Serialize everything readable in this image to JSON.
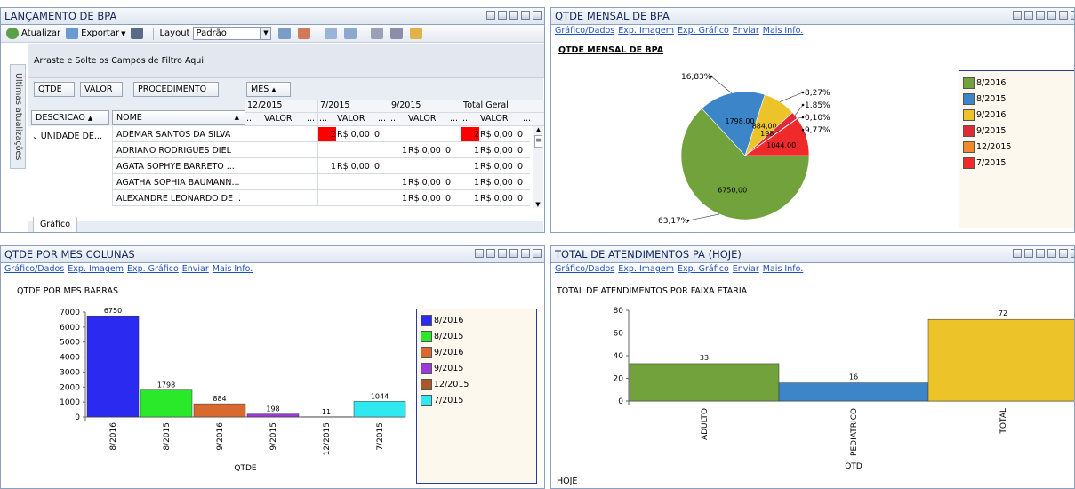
{
  "panels": {
    "bpa": {
      "title": "LANÇAMENTO DE BPA",
      "toolbar": {
        "atualizar": "Atualizar",
        "exportar": "Exportar",
        "layout_label": "Layout",
        "layout_value": "Padrão"
      },
      "side_tab": "Últimas atualizações",
      "filter_drop": "Arraste e Solte os Campos de Filtro Aqui",
      "data_fields": [
        "QTDE",
        "VALOR",
        "PROCEDIMENTO"
      ],
      "col_field": "MES",
      "row_fields": [
        "DESCRICAO",
        "NOME"
      ],
      "col_groups": [
        "12/2015",
        "7/2015",
        "9/2015",
        "Total Geral"
      ],
      "sub_headers": {
        "dots": "...",
        "valor": "VALOR"
      },
      "group_label": "UNIDADE DE...",
      "rows": [
        {
          "nome": "ADEMAR SANTOS DA SILVA",
          "g7_q": "2",
          "g7_v": "R$ 0,00",
          "g7_x": "0",
          "g9_q": "",
          "g9_v": "",
          "g9_x": "",
          "t_q": "2",
          "t_v": "R$ 0,00",
          "t_x": "0"
        },
        {
          "nome": "ADRIANO RODRIGUES DIEL",
          "g7_q": "",
          "g7_v": "",
          "g7_x": "",
          "g9_q": "1",
          "g9_v": "R$ 0,00",
          "g9_x": "0",
          "t_q": "1",
          "t_v": "R$ 0,00",
          "t_x": "0"
        },
        {
          "nome": "AGATA SOPHYE BARRETO ...",
          "g7_q": "1",
          "g7_v": "R$ 0,00",
          "g7_x": "0",
          "g9_q": "",
          "g9_v": "",
          "g9_x": "",
          "t_q": "1",
          "t_v": "R$ 0,00",
          "t_x": "0"
        },
        {
          "nome": "AGATHA SOPHIA BAUMANN...",
          "g7_q": "",
          "g7_v": "",
          "g7_x": "",
          "g9_q": "1",
          "g9_v": "R$ 0,00",
          "g9_x": "0",
          "t_q": "1",
          "t_v": "R$ 0,00",
          "t_x": "0"
        },
        {
          "nome": "ALEXANDRE LEONARDO DE ...",
          "g7_q": "",
          "g7_v": "",
          "g7_x": "",
          "g9_q": "1",
          "g9_v": "R$ 0,00",
          "g9_x": "0",
          "t_q": "1",
          "t_v": "R$ 0,00",
          "t_x": "0"
        }
      ],
      "bottom_tab": "Gráfico",
      "highlight_color": "#ff0000"
    },
    "pie": {
      "title": "QTDE MENSAL DE BPA",
      "links": [
        "Gráfico/Dados",
        "Exp. Imagem",
        "Exp. Gráfico",
        "Enviar",
        "Mais Info."
      ],
      "chart_title": "QTDE MENSAL DE BPA"
    },
    "bars": {
      "title": "QTDE POR MES COLUNAS",
      "links": [
        "Gráfico/Dados",
        "Exp. Imagem",
        "Exp. Gráfico",
        "Enviar",
        "Mais Info."
      ],
      "chart_title": "QTDE POR MES BARRAS"
    },
    "atend": {
      "title": "TOTAL DE ATENDIMENTOS PA (HOJE)",
      "links": [
        "Gráfico/Dados",
        "Exp. Imagem",
        "Exp. Gráfico",
        "Enviar",
        "Mais Info."
      ],
      "chart_title": "TOTAL DE ATENDIMENTOS POR FAIXA ETARIA",
      "footer": "HOJE"
    }
  },
  "chart_data": [
    {
      "type": "pie",
      "title": "QTDE MENSAL DE BPA",
      "legend_position": "right",
      "series": [
        {
          "name": "8/2016",
          "value": 6750.0,
          "value_label": "6750,00",
          "percent_label": "63,17%",
          "color": "#72a23c"
        },
        {
          "name": "8/2015",
          "value": 1798.0,
          "value_label": "1798,00",
          "percent_label": "16,83%",
          "color": "#3b85c8"
        },
        {
          "name": "9/2016",
          "value": 884.0,
          "value_label": "884,00",
          "percent_label": "8,27%",
          "color": "#ecc42a"
        },
        {
          "name": "9/2015",
          "value": 198.0,
          "value_label": "198,00",
          "percent_label": "1,85%",
          "color": "#e02a3a"
        },
        {
          "name": "12/2015",
          "value": 11.0,
          "value_label": "",
          "percent_label": "0,10%",
          "color": "#f08a2a"
        },
        {
          "name": "7/2015",
          "value": 1044.0,
          "value_label": "1044,00",
          "percent_label": "9,77%",
          "color": "#f02a2a"
        }
      ]
    },
    {
      "type": "bar",
      "title": "QTDE POR MES BARRAS",
      "xlabel": "QTDE",
      "ylabel": "",
      "ylim": [
        0,
        7000
      ],
      "yticks": [
        0,
        1000,
        2000,
        3000,
        4000,
        5000,
        6000,
        7000
      ],
      "legend_position": "right",
      "categories": [
        "8/2016",
        "8/2015",
        "9/2016",
        "9/2015",
        "12/2015",
        "7/2015"
      ],
      "values": [
        6750,
        1798,
        884,
        198,
        11,
        1044
      ],
      "colors": [
        "#2a2af0",
        "#2ae82a",
        "#d86a30",
        "#9a3ad8",
        "#a8582a",
        "#30e8f0"
      ]
    },
    {
      "type": "bar",
      "title": "TOTAL DE ATENDIMENTOS POR FAIXA ETARIA",
      "xlabel": "QTD",
      "ylabel": "",
      "ylim": [
        0,
        80
      ],
      "yticks": [
        0,
        20,
        40,
        60,
        80
      ],
      "categories": [
        "ADULTO",
        "PEDIATRICO",
        "TOTAL"
      ],
      "values": [
        33,
        16,
        72
      ],
      "colors": [
        "#72a23c",
        "#3b85c8",
        "#ecc42a"
      ]
    }
  ]
}
